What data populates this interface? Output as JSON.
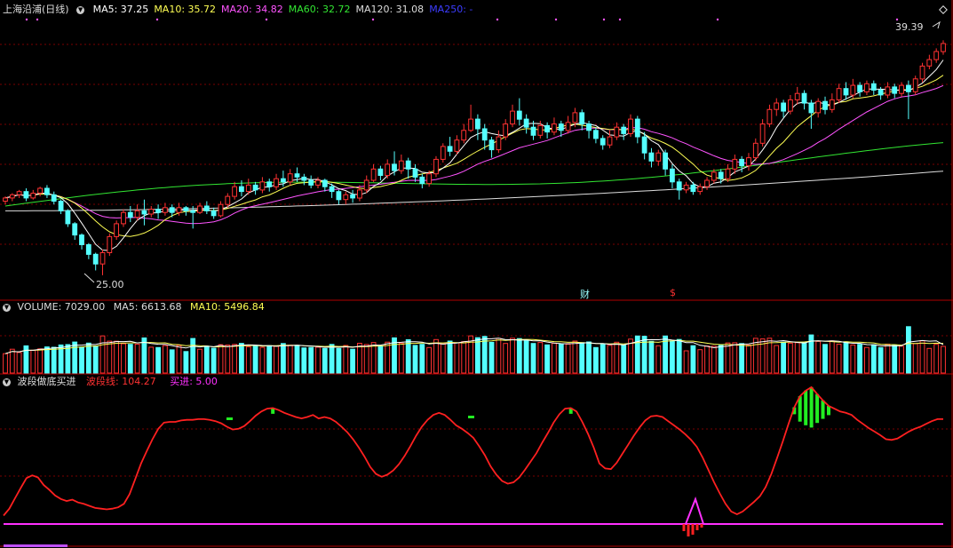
{
  "colors": {
    "up": "#ff3232",
    "down": "#54ffff",
    "ma5": "#ffffff",
    "ma10": "#ffff54",
    "ma20": "#ff54ff",
    "ma60": "#32e632",
    "ma120": "#dddddd",
    "ma250": "#3c3cff",
    "grid": "#7a0000",
    "wave": "#ff2020",
    "buy": "#ff30ff",
    "bar_green": "#22ee22"
  },
  "main_panel": {
    "title": "上海沿浦(日线)",
    "ma": [
      {
        "label": "MA5: 37.25",
        "color": "#ffffff"
      },
      {
        "label": "MA10: 35.72",
        "color": "#ffff54"
      },
      {
        "label": "MA20: 34.82",
        "color": "#ff54ff"
      },
      {
        "label": "MA60: 32.72",
        "color": "#32e632"
      },
      {
        "label": "MA120: 31.08",
        "color": "#dddddd"
      },
      {
        "label": "MA250: -",
        "color": "#3c3cff"
      }
    ],
    "high_label": "39.39",
    "low_label": "25.00",
    "badge_cai": "财",
    "badge_dollar": "$"
  },
  "volume_panel": {
    "title": "VOLUME: 7029.00",
    "ma5": "MA5: 6613.68",
    "ma10": "MA10: 5496.84"
  },
  "indicator_panel": {
    "title": "波段做底买进",
    "wave": "波段线: 104.27",
    "buy": "买进: 5.00"
  },
  "chart_data": {
    "type": "candlestick",
    "title": "上海沿浦(日线)",
    "price_range": [
      24,
      41
    ],
    "last_close": 39.39,
    "period_low": 25.0,
    "period_high": 39.39,
    "candles": [
      [
        29.6,
        29.8,
        29.4,
        29.9
      ],
      [
        29.8,
        30.0,
        29.6,
        30.1
      ],
      [
        30.0,
        30.2,
        29.8,
        30.3
      ],
      [
        30.2,
        29.8,
        29.6,
        30.4
      ],
      [
        29.8,
        30.1,
        29.7,
        30.3
      ],
      [
        30.1,
        30.4,
        29.9,
        30.5
      ],
      [
        30.4,
        30.0,
        29.8,
        30.6
      ],
      [
        30.0,
        29.6,
        29.4,
        30.2
      ],
      [
        29.6,
        29.0,
        28.8,
        29.7
      ],
      [
        29.0,
        28.2,
        28.0,
        29.1
      ],
      [
        28.2,
        27.5,
        27.2,
        28.3
      ],
      [
        27.5,
        26.9,
        26.6,
        27.6
      ],
      [
        26.9,
        26.3,
        26.0,
        27.0
      ],
      [
        26.3,
        25.7,
        25.3,
        26.4
      ],
      [
        25.7,
        26.4,
        25.0,
        26.6
      ],
      [
        26.4,
        27.4,
        26.2,
        27.6
      ],
      [
        27.4,
        28.2,
        27.2,
        28.4
      ],
      [
        28.2,
        28.9,
        28.0,
        29.1
      ],
      [
        28.9,
        28.6,
        28.3,
        29.3
      ],
      [
        28.6,
        29.0,
        28.4,
        29.4
      ],
      [
        29.0,
        28.8,
        28.1,
        29.7
      ],
      [
        28.8,
        29.1,
        28.6,
        29.3
      ],
      [
        29.1,
        28.9,
        28.5,
        29.4
      ],
      [
        28.9,
        29.2,
        28.7,
        29.5
      ],
      [
        29.2,
        28.9,
        28.6,
        29.4
      ],
      [
        28.9,
        29.2,
        28.7,
        29.5
      ],
      [
        29.2,
        29.0,
        28.7,
        29.3
      ],
      [
        29.0,
        28.9,
        27.9,
        29.3
      ],
      [
        28.9,
        29.3,
        28.8,
        29.5
      ],
      [
        29.3,
        29.0,
        28.8,
        29.6
      ],
      [
        29.0,
        28.7,
        28.5,
        29.2
      ],
      [
        28.7,
        29.4,
        28.6,
        29.6
      ],
      [
        29.4,
        29.9,
        29.2,
        30.1
      ],
      [
        29.9,
        30.5,
        29.7,
        30.8
      ],
      [
        30.5,
        30.2,
        29.9,
        30.9
      ],
      [
        30.2,
        30.6,
        30.0,
        31.0
      ],
      [
        30.6,
        30.3,
        30.0,
        30.8
      ],
      [
        30.3,
        30.8,
        30.1,
        31.1
      ],
      [
        30.8,
        30.5,
        30.2,
        31.0
      ],
      [
        30.5,
        31.0,
        30.3,
        31.3
      ],
      [
        31.0,
        30.8,
        30.5,
        31.5
      ],
      [
        30.8,
        31.3,
        30.6,
        31.6
      ],
      [
        31.3,
        31.1,
        30.8,
        31.7
      ],
      [
        31.1,
        30.9,
        30.6,
        31.3
      ],
      [
        30.9,
        30.6,
        30.4,
        31.2
      ],
      [
        30.6,
        30.9,
        30.4,
        31.1
      ],
      [
        30.9,
        30.5,
        30.2,
        31.0
      ],
      [
        30.5,
        30.2,
        29.8,
        30.7
      ],
      [
        30.2,
        29.7,
        29.4,
        30.3
      ],
      [
        29.7,
        30.0,
        29.4,
        30.2
      ],
      [
        30.0,
        29.8,
        29.5,
        30.3
      ],
      [
        29.8,
        30.3,
        29.6,
        30.6
      ],
      [
        30.3,
        30.9,
        30.1,
        31.2
      ],
      [
        30.9,
        31.6,
        30.8,
        31.9
      ],
      [
        31.6,
        31.2,
        30.9,
        31.8
      ],
      [
        31.2,
        31.9,
        31.0,
        32.2
      ],
      [
        31.9,
        31.5,
        31.2,
        32.7
      ],
      [
        31.5,
        32.1,
        31.3,
        32.5
      ],
      [
        32.1,
        31.6,
        31.0,
        32.3
      ],
      [
        31.6,
        31.1,
        30.8,
        31.9
      ],
      [
        31.1,
        30.7,
        30.4,
        31.3
      ],
      [
        30.7,
        31.3,
        30.5,
        31.5
      ],
      [
        31.3,
        32.2,
        31.1,
        32.4
      ],
      [
        32.2,
        33.0,
        32.0,
        33.2
      ],
      [
        33.0,
        32.7,
        32.4,
        33.6
      ],
      [
        32.7,
        33.4,
        32.5,
        33.7
      ],
      [
        33.4,
        34.0,
        33.2,
        34.4
      ],
      [
        34.0,
        34.7,
        33.9,
        35.6
      ],
      [
        34.7,
        34.1,
        33.4,
        35.0
      ],
      [
        34.1,
        33.4,
        32.8,
        34.4
      ],
      [
        33.4,
        32.8,
        32.3,
        33.6
      ],
      [
        32.8,
        33.6,
        32.6,
        34.0
      ],
      [
        33.6,
        34.4,
        33.4,
        34.7
      ],
      [
        34.4,
        35.2,
        34.2,
        35.6
      ],
      [
        35.2,
        34.7,
        34.3,
        36.0
      ],
      [
        34.7,
        34.2,
        33.8,
        35.0
      ],
      [
        34.2,
        33.7,
        33.4,
        34.6
      ],
      [
        33.7,
        34.3,
        33.5,
        34.6
      ],
      [
        34.3,
        33.9,
        33.5,
        34.5
      ],
      [
        33.9,
        34.4,
        33.7,
        34.8
      ],
      [
        34.4,
        34.0,
        33.6,
        34.6
      ],
      [
        34.0,
        34.5,
        33.8,
        34.9
      ],
      [
        34.5,
        35.1,
        34.2,
        35.4
      ],
      [
        35.1,
        34.4,
        34.0,
        35.3
      ],
      [
        34.4,
        34.0,
        33.5,
        34.6
      ],
      [
        34.0,
        33.5,
        33.2,
        34.2
      ],
      [
        33.5,
        33.1,
        32.8,
        33.7
      ],
      [
        33.1,
        33.6,
        32.9,
        34.0
      ],
      [
        33.6,
        34.2,
        33.4,
        34.5
      ],
      [
        34.2,
        33.8,
        33.4,
        34.4
      ],
      [
        33.8,
        34.7,
        33.6,
        35.0
      ],
      [
        34.7,
        33.6,
        33.2,
        34.9
      ],
      [
        33.6,
        32.6,
        32.2,
        33.9
      ],
      [
        32.6,
        32.1,
        31.7,
        32.9
      ],
      [
        32.1,
        32.6,
        31.8,
        32.8
      ],
      [
        32.6,
        31.6,
        31.2,
        32.8
      ],
      [
        31.6,
        30.8,
        30.4,
        31.9
      ],
      [
        30.8,
        30.3,
        29.7,
        31.0
      ],
      [
        30.3,
        30.6,
        30.1,
        30.8
      ],
      [
        30.6,
        30.2,
        30.0,
        30.8
      ],
      [
        30.2,
        30.5,
        30.0,
        30.7
      ],
      [
        30.5,
        30.9,
        30.3,
        31.1
      ],
      [
        30.9,
        31.4,
        30.7,
        31.6
      ],
      [
        31.4,
        31.0,
        30.7,
        31.6
      ],
      [
        31.0,
        31.6,
        30.8,
        31.9
      ],
      [
        31.6,
        32.2,
        31.3,
        32.5
      ],
      [
        32.2,
        31.8,
        31.4,
        32.4
      ],
      [
        31.8,
        32.3,
        31.5,
        32.6
      ],
      [
        32.3,
        33.2,
        32.1,
        33.5
      ],
      [
        33.2,
        34.4,
        33.0,
        34.7
      ],
      [
        34.4,
        35.3,
        34.2,
        35.6
      ],
      [
        35.3,
        35.7,
        34.9,
        36.0
      ],
      [
        35.7,
        35.2,
        34.8,
        35.9
      ],
      [
        35.2,
        35.9,
        35.0,
        36.2
      ],
      [
        35.9,
        36.3,
        35.6,
        36.7
      ],
      [
        36.3,
        35.7,
        35.3,
        36.5
      ],
      [
        35.7,
        35.1,
        34.1,
        35.9
      ],
      [
        35.1,
        35.8,
        34.8,
        36.0
      ],
      [
        35.8,
        35.3,
        35.0,
        36.1
      ],
      [
        35.3,
        35.9,
        35.1,
        36.3
      ],
      [
        35.9,
        36.6,
        35.7,
        36.9
      ],
      [
        36.6,
        36.2,
        35.9,
        37.0
      ],
      [
        36.2,
        36.8,
        36.0,
        37.2
      ],
      [
        36.8,
        36.4,
        36.1,
        37.0
      ],
      [
        36.4,
        36.9,
        36.2,
        37.1
      ],
      [
        36.9,
        36.5,
        36.2,
        37.1
      ],
      [
        36.5,
        36.2,
        35.9,
        36.7
      ],
      [
        36.2,
        36.7,
        36.0,
        37.0
      ],
      [
        36.7,
        36.3,
        36.0,
        36.9
      ],
      [
        36.3,
        36.8,
        36.1,
        37.0
      ],
      [
        36.8,
        36.4,
        34.7,
        37.1
      ],
      [
        36.4,
        37.2,
        36.2,
        37.4
      ],
      [
        37.2,
        38.0,
        37.0,
        38.2
      ],
      [
        38.0,
        38.4,
        37.8,
        38.7
      ],
      [
        38.4,
        38.9,
        38.2,
        39.1
      ],
      [
        38.9,
        39.4,
        38.7,
        39.6
      ]
    ],
    "volume_range": [
      0,
      15000
    ],
    "indicator": {
      "wave_label": "波段线",
      "buy_label": "买进",
      "wave": [
        30,
        40,
        55,
        70,
        84,
        88,
        85,
        74,
        67,
        59,
        54,
        51,
        53,
        49,
        47,
        44,
        41,
        40,
        39,
        40,
        42,
        47,
        61,
        83,
        105,
        123,
        140,
        155,
        164,
        165,
        165,
        167,
        168,
        168,
        169,
        169,
        168,
        166,
        163,
        158,
        154,
        155,
        159,
        166,
        174,
        180,
        184,
        185,
        182,
        178,
        175,
        172,
        170,
        172,
        175,
        170,
        172,
        170,
        165,
        158,
        150,
        140,
        128,
        115,
        100,
        90,
        86,
        89,
        95,
        104,
        116,
        130,
        145,
        158,
        168,
        175,
        178,
        175,
        168,
        160,
        155,
        149,
        142,
        130,
        117,
        101,
        89,
        80,
        76,
        78,
        85,
        96,
        108,
        120,
        135,
        149,
        164,
        176,
        184,
        185,
        180,
        165,
        148,
        128,
        105,
        98,
        97,
        106,
        119,
        132,
        145,
        157,
        167,
        173,
        174,
        172,
        166,
        160,
        154,
        147,
        139,
        129,
        114,
        96,
        78,
        62,
        47,
        36,
        32,
        36,
        43,
        50,
        58,
        71,
        90,
        113,
        137,
        162,
        186,
        202,
        210,
        215,
        205,
        196,
        188,
        184,
        180,
        178,
        175,
        168,
        162,
        156,
        151,
        146,
        140,
        139,
        141,
        146,
        151,
        155,
        158,
        162,
        166,
        169,
        169
      ],
      "buy_value": 5.0
    }
  }
}
